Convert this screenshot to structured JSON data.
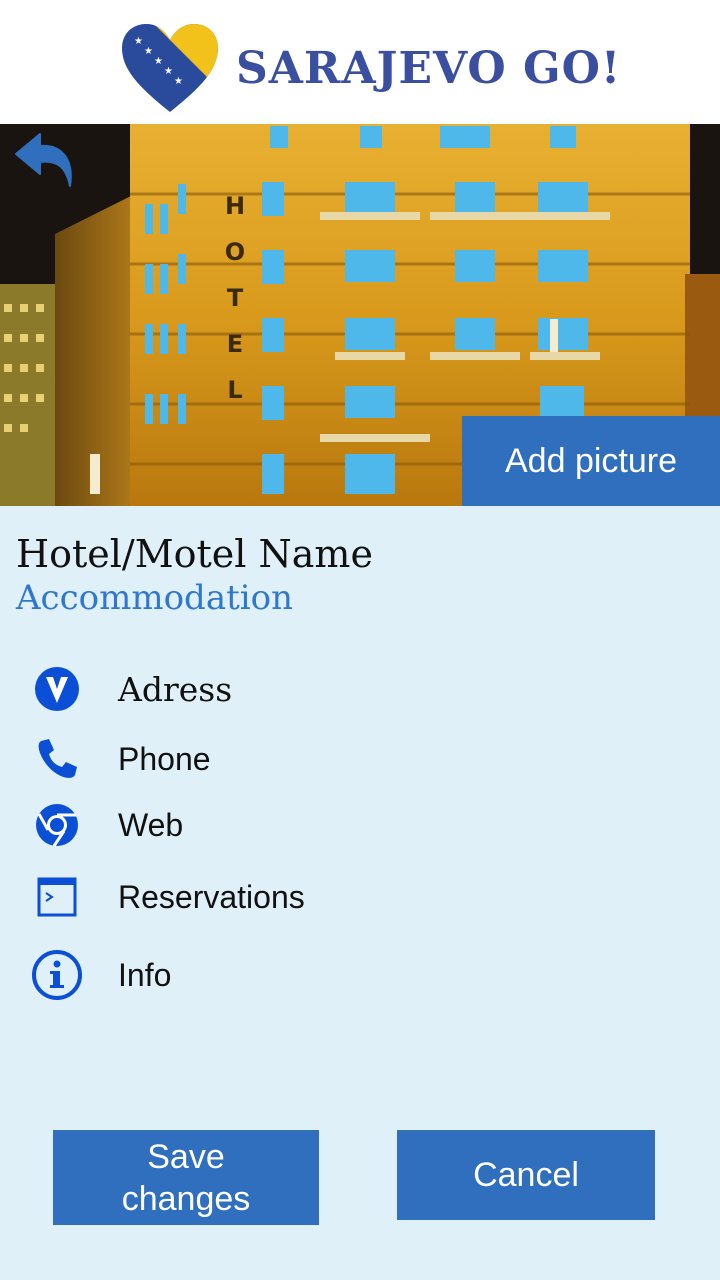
{
  "header": {
    "app_name": "SARAJEVO GO!",
    "logo_icon": "heart-flag-logo"
  },
  "hero": {
    "back_icon": "back-arrow-icon",
    "sign_letters": [
      "H",
      "O",
      "T",
      "E",
      "L"
    ],
    "add_picture_label": "Add picture"
  },
  "place": {
    "name": "Hotel/Motel Name",
    "category": "Accommodation"
  },
  "details": [
    {
      "icon": "location-pin-icon",
      "label": "Adress"
    },
    {
      "icon": "phone-icon",
      "label": "Phone"
    },
    {
      "icon": "web-browser-icon",
      "label": "Web"
    },
    {
      "icon": "reservations-icon",
      "label": "Reservations"
    },
    {
      "icon": "info-icon",
      "label": "Info"
    }
  ],
  "actions": {
    "save_label": "Save changes",
    "cancel_label": "Cancel"
  },
  "colors": {
    "accent": "#2f6fbd",
    "category_text": "#2f78cf",
    "icon_blue": "#0a4fd6",
    "logo_text": "#3a4fa0",
    "background": "#e0f0f8"
  }
}
